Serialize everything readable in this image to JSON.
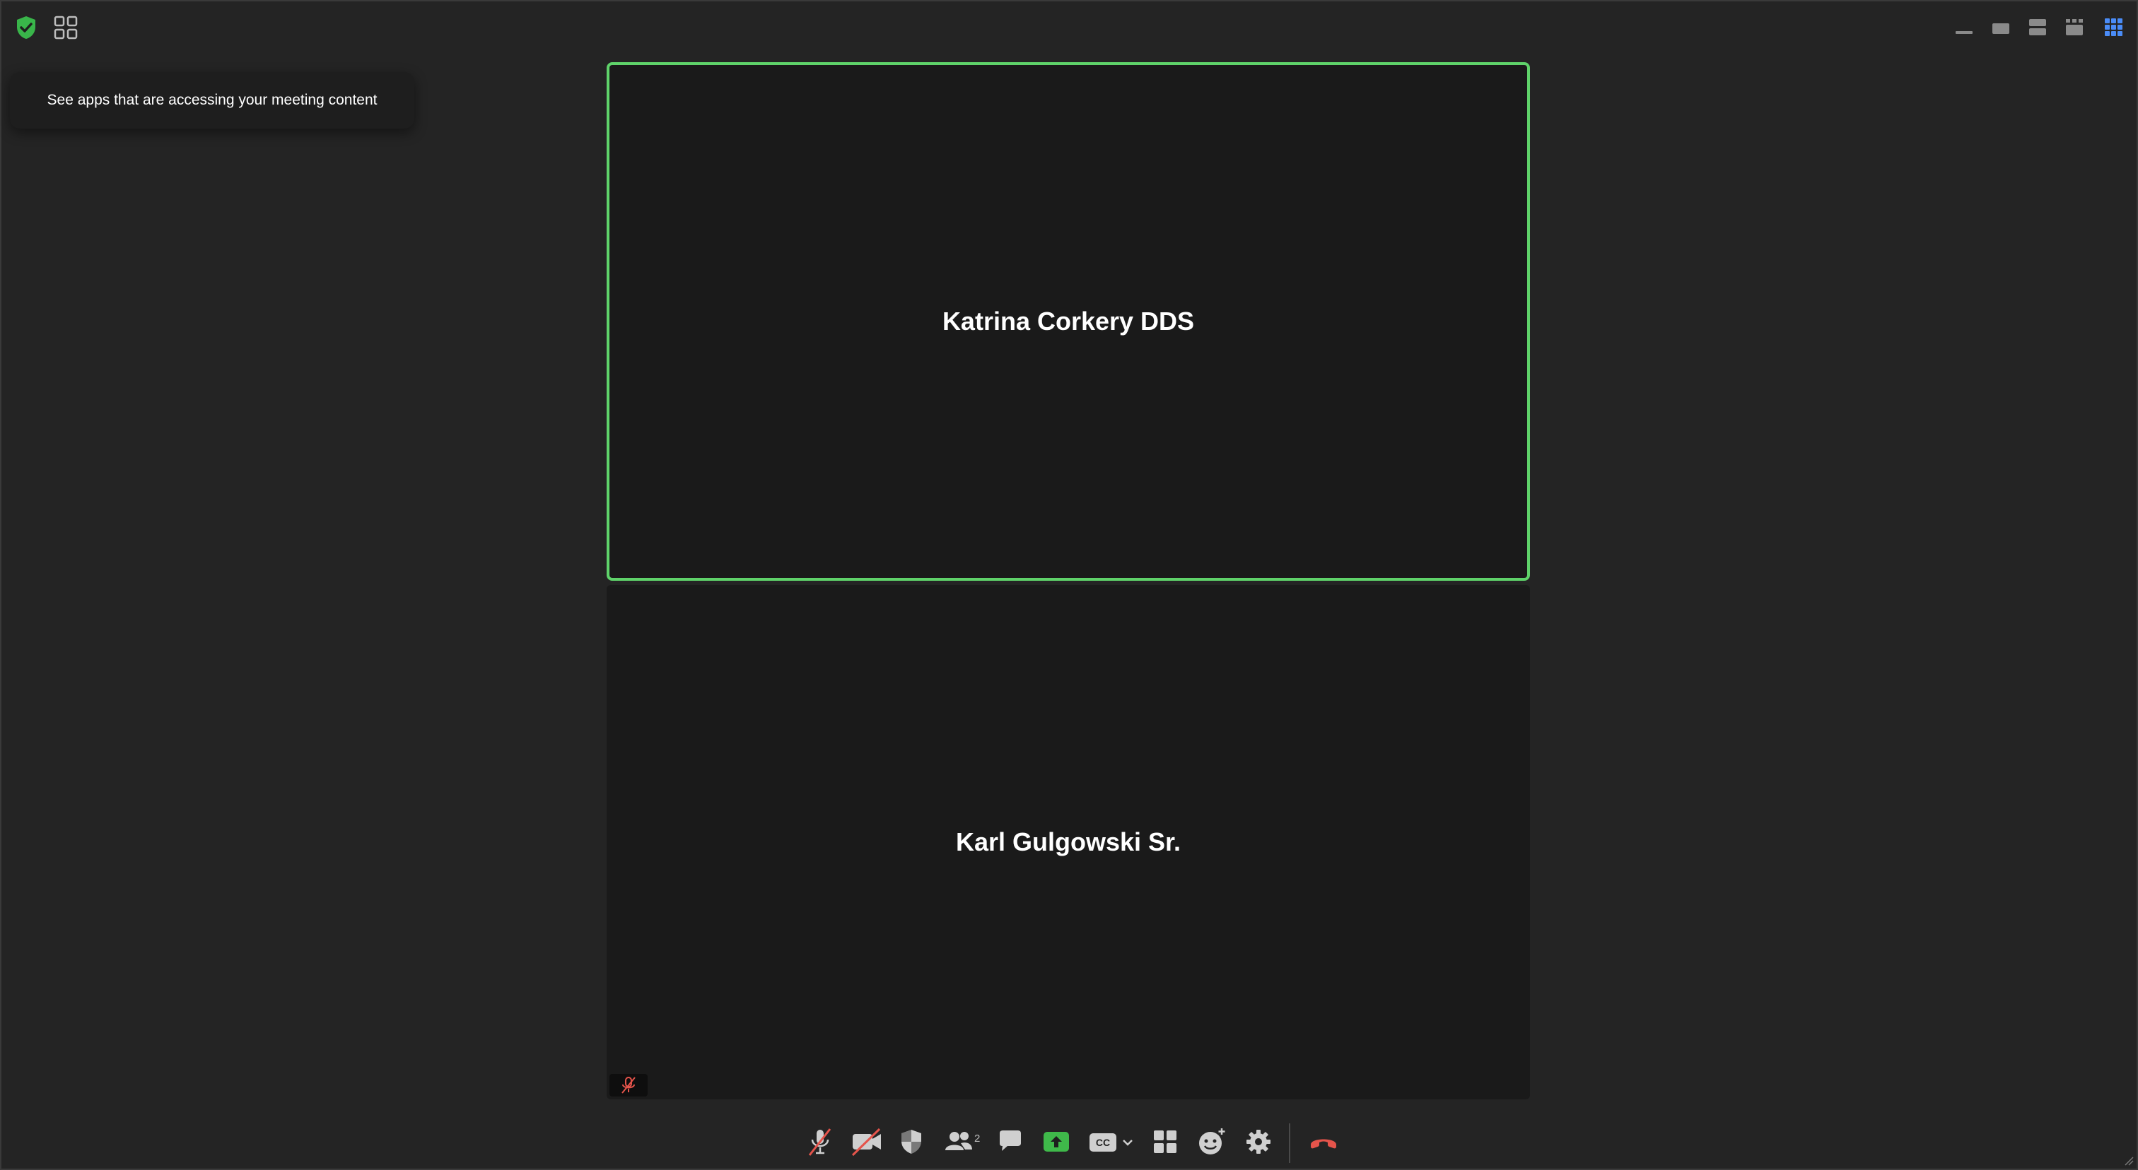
{
  "tooltip": {
    "text": "See apps that are accessing your meeting content"
  },
  "participants": [
    {
      "name": "Katrina Corkery DDS",
      "active_speaker": true,
      "muted": false
    },
    {
      "name": "Karl Gulgowski Sr.",
      "active_speaker": false,
      "muted": true
    }
  ],
  "toolbar": {
    "participants_count": "2",
    "buttons": [
      "mic-muted-icon",
      "video-off-icon",
      "security-icon",
      "participants-icon",
      "chat-icon",
      "share-screen-icon",
      "captions-icon",
      "apps-grid-icon",
      "reactions-icon",
      "settings-icon",
      "leave-icon"
    ]
  },
  "view_modes": [
    "minimize",
    "single",
    "split",
    "grid-small",
    "gallery"
  ],
  "colors": {
    "active_border": "#5fd36a",
    "accent_blue": "#4a8cf7",
    "leave_red": "#e5544b",
    "share_green": "#3fb94a",
    "shield_green": "#39b54a"
  }
}
